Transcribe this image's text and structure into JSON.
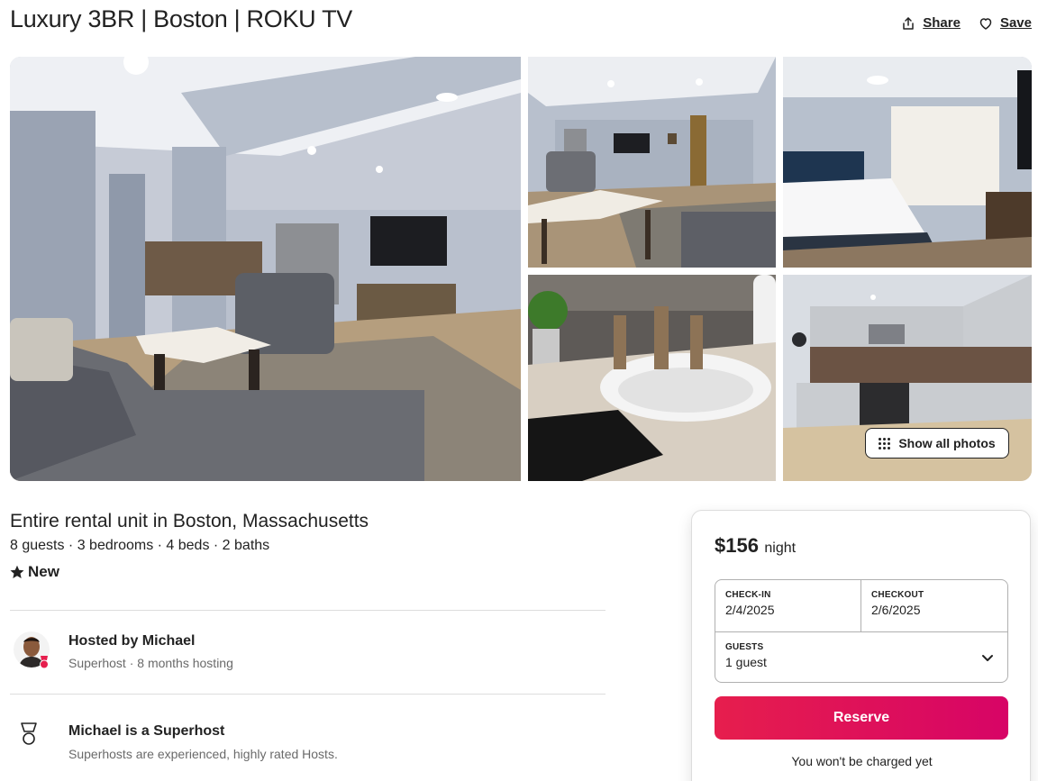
{
  "listing": {
    "title": "Luxury 3BR | Boston | ROKU TV",
    "type": "Entire rental unit in Boston, Massachusetts",
    "summary": "8 guests · 3 bedrooms · 4 beds · 2 baths",
    "rating_label": "New"
  },
  "actions": {
    "share_label": "Share",
    "save_label": "Save",
    "share_icon": "share-icon",
    "save_icon": "heart-icon"
  },
  "gallery": {
    "photos": [
      "living-room",
      "living-area",
      "bedroom",
      "bathroom-sink",
      "kitchen"
    ],
    "show_all_label": "Show all photos"
  },
  "host": {
    "name_line": "Hosted by Michael",
    "meta": "Superhost · 8 months hosting"
  },
  "superhost": {
    "title": "Michael is a Superhost",
    "description": "Superhosts are experienced, highly rated Hosts."
  },
  "booking": {
    "price": "$156",
    "price_unit": "night",
    "checkin_label": "CHECK-IN",
    "checkin_value": "2/4/2025",
    "checkout_label": "CHECKOUT",
    "checkout_value": "2/6/2025",
    "guests_label": "GUESTS",
    "guests_value": "1 guest",
    "reserve_label": "Reserve",
    "note": "You won't be charged yet"
  },
  "colors": {
    "brand": "#e61e4d",
    "text": "#222222",
    "muted": "#6a6a6a",
    "border": "#dddddd"
  }
}
